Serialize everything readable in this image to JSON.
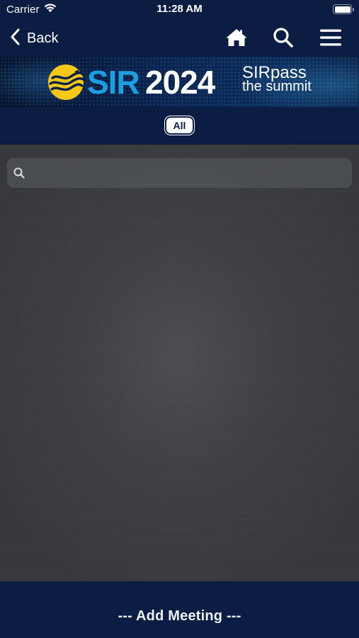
{
  "status_bar": {
    "carrier": "Carrier",
    "time": "11:28 AM",
    "wifi_icon": "wifi-icon",
    "battery_icon": "battery-icon"
  },
  "nav": {
    "back_label": "Back",
    "back_icon": "chevron-left-icon",
    "home_icon": "home-icon",
    "search_icon": "search-icon",
    "menu_icon": "hamburger-menu-icon"
  },
  "banner": {
    "logo_icon": "sir-sun-logo-icon",
    "sir_text": "SIR",
    "year_text": "2024",
    "tagline_line1": "SIRpass",
    "tagline_line2": "the summit"
  },
  "filter": {
    "selected_label": "All"
  },
  "search": {
    "placeholder": "",
    "value": "",
    "icon": "magnifier-icon"
  },
  "footer": {
    "add_meeting_label": "--- Add Meeting ---"
  },
  "colors": {
    "navy": "#0c1d44",
    "content_gray": "#3e4044",
    "brand_blue": "#1aa0e0",
    "logo_yellow": "#f5c818"
  }
}
